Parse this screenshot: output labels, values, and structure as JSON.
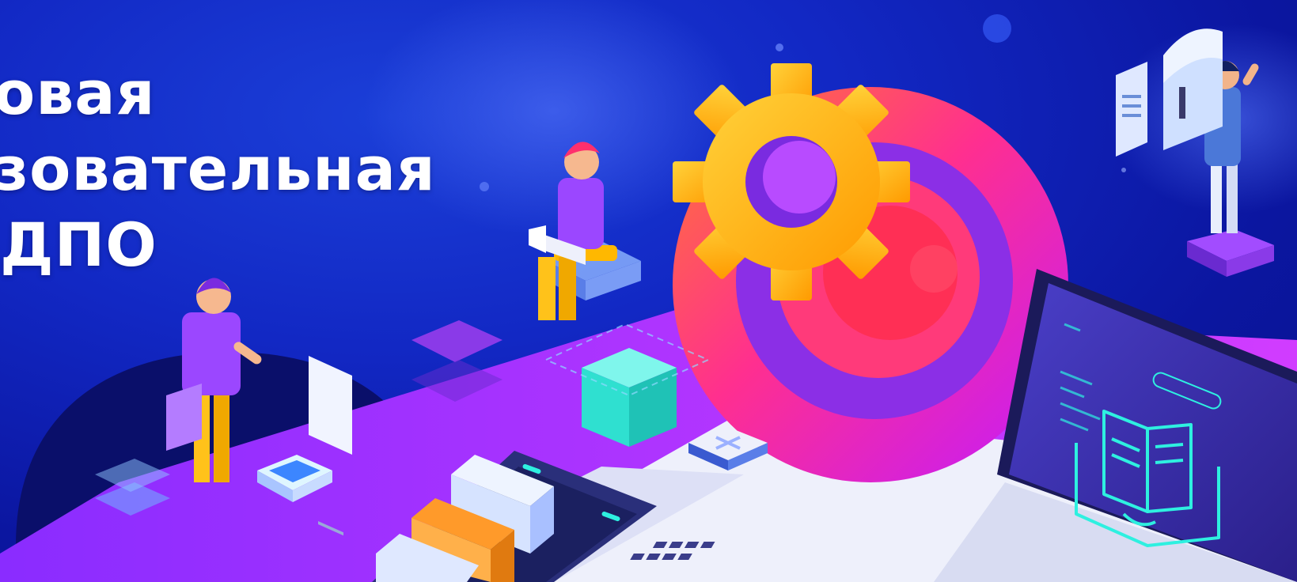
{
  "banner": {
    "headline_lines": [
      "овая",
      "зовательная",
      "ДПО"
    ]
  },
  "colors": {
    "background": "#1228c4",
    "gear": "#ffb000",
    "ring_outer": "#ff2fa0",
    "ring_inner": "#7a2be0",
    "cube": "#2fe0d0",
    "platform_purple": "#b43bff",
    "platform_white": "#eef0fb",
    "laptop_screen": "#3a2fa8",
    "screen_lines": "#2ef0e0",
    "person_shirt": "#9b47ff",
    "person_pants": "#ffc21a",
    "hair_pink": "#ff2f6d"
  },
  "icons": [
    "gear-icon",
    "open-book-icon",
    "document-icon",
    "close-icon"
  ]
}
